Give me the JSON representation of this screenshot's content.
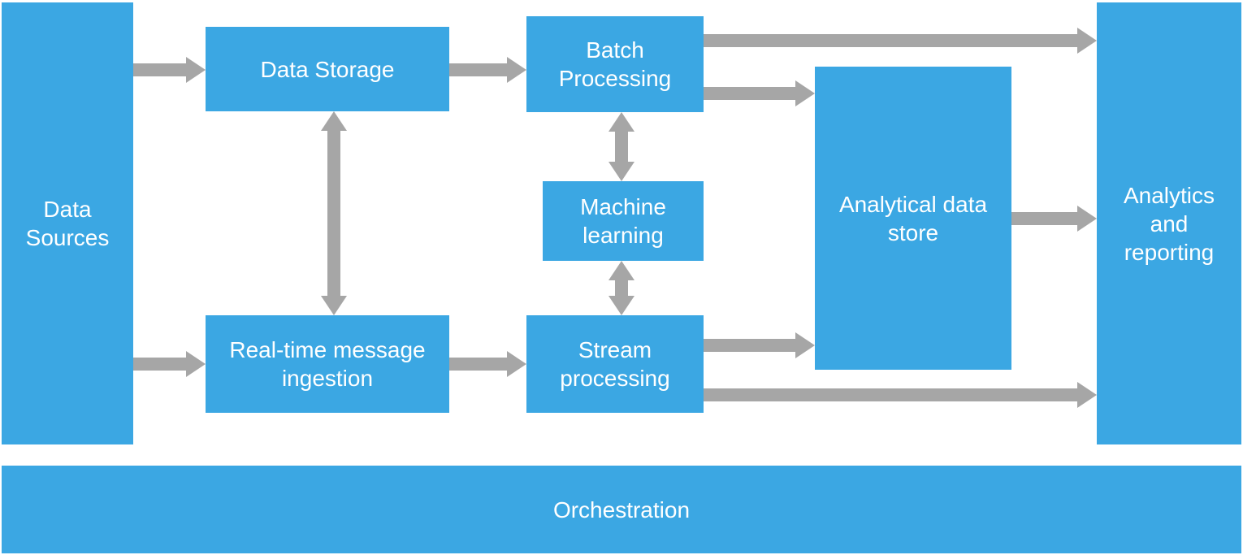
{
  "colors": {
    "box": "#3ba7e3",
    "text": "#ffffff",
    "arrow": "#a6a6a6"
  },
  "nodes": {
    "data_sources": "Data Sources",
    "data_storage": "Data Storage",
    "real_time_ingestion": "Real-time message ingestion",
    "batch_processing": "Batch Processing",
    "machine_learning": "Machine learning",
    "stream_processing": "Stream processing",
    "analytical_data_store": "Analytical data store",
    "analytics_reporting": "Analytics and reporting",
    "orchestration": "Orchestration"
  },
  "connections": [
    {
      "from": "data_sources",
      "to": "data_storage",
      "type": "right"
    },
    {
      "from": "data_sources",
      "to": "real_time_ingestion",
      "type": "right"
    },
    {
      "from": "data_storage",
      "to": "batch_processing",
      "type": "right"
    },
    {
      "from": "data_storage",
      "to": "real_time_ingestion",
      "type": "bidirectional-vertical"
    },
    {
      "from": "real_time_ingestion",
      "to": "stream_processing",
      "type": "right"
    },
    {
      "from": "machine_learning",
      "to": "batch_processing",
      "type": "bidirectional-vertical"
    },
    {
      "from": "machine_learning",
      "to": "stream_processing",
      "type": "bidirectional-vertical"
    },
    {
      "from": "batch_processing",
      "to": "analytics_reporting",
      "type": "right"
    },
    {
      "from": "batch_processing",
      "to": "analytical_data_store",
      "type": "right"
    },
    {
      "from": "stream_processing",
      "to": "analytical_data_store",
      "type": "right"
    },
    {
      "from": "stream_processing",
      "to": "analytics_reporting",
      "type": "right"
    },
    {
      "from": "analytical_data_store",
      "to": "analytics_reporting",
      "type": "right"
    }
  ]
}
